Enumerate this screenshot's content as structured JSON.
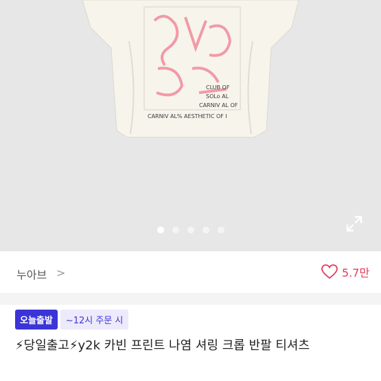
{
  "gallery": {
    "image_alt": "cream cropped t-shirt with pink graffiti print",
    "print_lines": [
      "CLUB OF",
      "SOLo AL",
      "CARNIV AL OF",
      "CARNIV AL% AESTHETIC OF I"
    ],
    "slide_count": 5,
    "active_slide": 1,
    "expand_icon": "expand-icon"
  },
  "seller": {
    "name": "누아브",
    "chevron": ">",
    "likes": "5.7만",
    "heart_color": "#e23b5a"
  },
  "badges": {
    "primary": "오늘출발",
    "secondary": "~12시 주문 시",
    "primary_color": "#3b34d6"
  },
  "product": {
    "title": "⚡당일출고⚡y2k 카빈 프린트 나염 셔링 크롭 반팔 티셔츠"
  }
}
